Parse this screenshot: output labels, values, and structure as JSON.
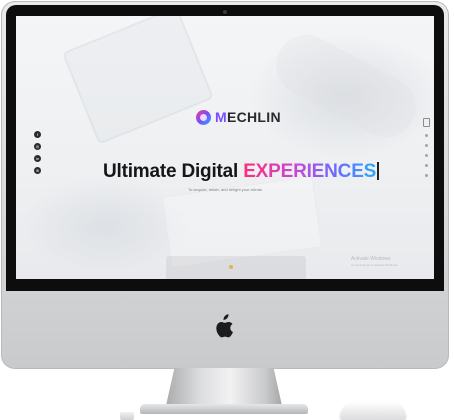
{
  "brand": {
    "name_prefix": "M",
    "name_rest": "ECHLIN",
    "tagline": "",
    "accent_color": "#7a4cff"
  },
  "hero": {
    "headline_plain": "Ultimate Digital ",
    "headline_accent": "EXPERIENCES",
    "subtitle": "To acquire, retain, and delight your clients"
  },
  "social_icons": [
    {
      "icon": "facebook-icon",
      "glyph": "f"
    },
    {
      "icon": "instagram-icon",
      "glyph": "◎"
    },
    {
      "icon": "linkedin-icon",
      "glyph": "in"
    },
    {
      "icon": "dribbble-icon",
      "glyph": "⊛"
    }
  ],
  "right_nav": {
    "count": 6
  },
  "watermark": {
    "title": "Activate Windows",
    "detail": "Go to Settings to activate Windows."
  }
}
